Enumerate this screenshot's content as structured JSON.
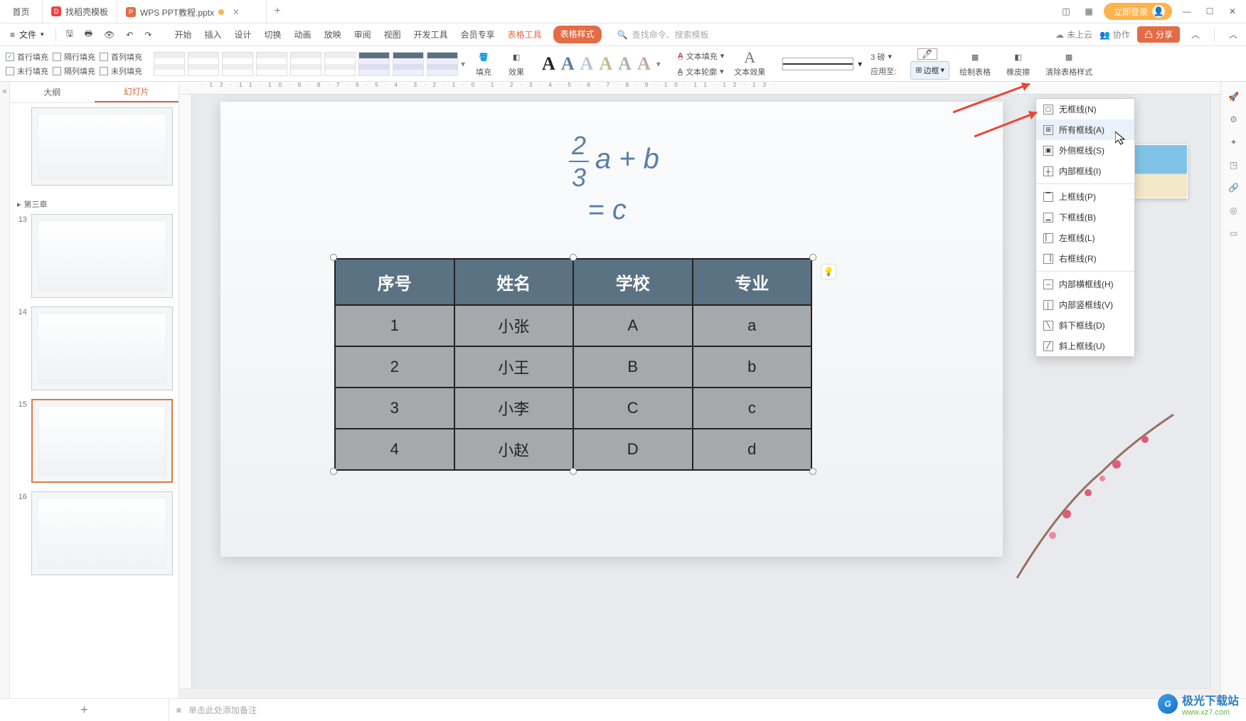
{
  "titlebar": {
    "home": "首页",
    "tab_templates": "找稻壳模板",
    "tab_doc": "WPS PPT教程.pptx",
    "login": "立即登录"
  },
  "menu": {
    "file": "文件",
    "tabs": [
      "开始",
      "插入",
      "设计",
      "切换",
      "动画",
      "放映",
      "审阅",
      "视图",
      "开发工具",
      "会员专享",
      "表格工具",
      "表格样式"
    ],
    "search_placeholder": "查找命令、搜索模板",
    "cloud": "未上云",
    "coop": "协作",
    "share": "分享"
  },
  "ribbon": {
    "chk": {
      "first_row": "首行填充",
      "alt_row": "隔行填充",
      "first_col": "首列填充",
      "last_row": "末行填充",
      "alt_col": "隔列填充",
      "last_col": "末列填充"
    },
    "fill": "填充",
    "effect": "效果",
    "text_fill": "文本填充",
    "text_outline": "文本轮廓",
    "text_effect": "文本效果",
    "line_weight_value": "3 磅",
    "apply_to": "应用至:",
    "border": "边框",
    "draw_table": "绘制表格",
    "eraser": "橡皮擦",
    "clear_style": "清除表格样式"
  },
  "slidepanel": {
    "outline": "大纲",
    "slides": "幻灯片",
    "section": "第三章",
    "nums": [
      "13",
      "14",
      "15",
      "16"
    ]
  },
  "dropdown": {
    "no_border": "无框线(N)",
    "all_border": "所有框线(A)",
    "outer_border": "外侧框线(S)",
    "inner_border": "内部框线(I)",
    "top_border": "上框线(P)",
    "bottom_border": "下框线(B)",
    "left_border": "左框线(L)",
    "right_border": "右框线(R)",
    "inner_h": "内部横框线(H)",
    "inner_v": "内部竖框线(V)",
    "diag_down": "斜下框线(D)",
    "diag_up": "斜上框线(U)"
  },
  "chart_data": {
    "type": "table",
    "headers": [
      "序号",
      "姓名",
      "学校",
      "专业"
    ],
    "rows": [
      [
        "1",
        "小张",
        "A",
        "a"
      ],
      [
        "2",
        "小王",
        "B",
        "b"
      ],
      [
        "3",
        "小李",
        "C",
        "c"
      ],
      [
        "4",
        "小赵",
        "D",
        "d"
      ]
    ]
  },
  "equation": {
    "num": "2",
    "den": "3",
    "rest1": "a + b",
    "rest2": "= c"
  },
  "status": {
    "notes_placeholder": "单击此处添加备注"
  },
  "watermark": {
    "brand": "极光下载站",
    "url": "www.xz7.com"
  }
}
